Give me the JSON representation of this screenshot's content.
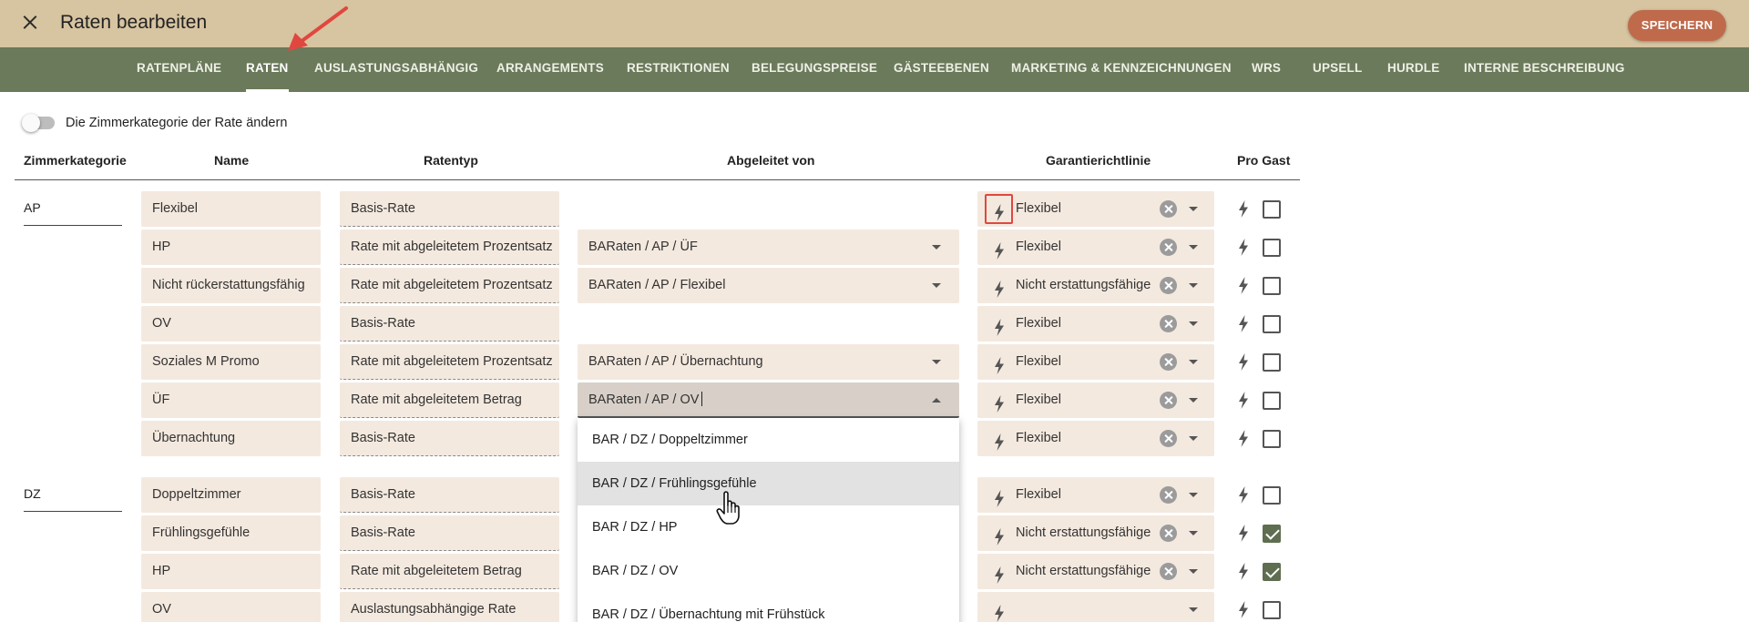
{
  "header": {
    "title": "Raten bearbeiten",
    "save_label": "SPEICHERN"
  },
  "tabs": [
    {
      "label": "RATENPLÄNE"
    },
    {
      "label": "RATEN"
    },
    {
      "label": "AUSLASTUNGSABHÄNGIG"
    },
    {
      "label": "ARRANGEMENTS"
    },
    {
      "label": "RESTRIKTIONEN"
    },
    {
      "label": "BELEGUNGSPREISE"
    },
    {
      "label": "GÄSTEEBENEN"
    },
    {
      "label": "MARKETING & KENNZEICHNUNGEN"
    },
    {
      "label": "WRS"
    },
    {
      "label": "UPSELL"
    },
    {
      "label": "HURDLE"
    },
    {
      "label": "INTERNE BESCHREIBUNG"
    }
  ],
  "toggle": {
    "label": "Die Zimmerkategorie der Rate ändern",
    "checked": false
  },
  "columns": {
    "zimmerkategorie": "Zimmerkategorie",
    "name": "Name",
    "ratentyp": "Ratentyp",
    "abgeleitet": "Abgeleitet von",
    "garantie": "Garantierichtlinie",
    "pro_gast": "Pro Gast"
  },
  "groups": [
    {
      "name": "AP",
      "rows": [
        {
          "name": "Flexibel",
          "type": "Basis-Rate",
          "derived": "",
          "guarantee": "Flexibel",
          "pro_gast": false
        },
        {
          "name": "HP",
          "type": "Rate mit abgeleitetem Prozentsatz",
          "derived": "BARaten / AP / ÜF",
          "guarantee": "Flexibel",
          "pro_gast": false
        },
        {
          "name": "Nicht rückerstattungsfähig",
          "type": "Rate mit abgeleitetem Prozentsatz",
          "derived": "BARaten / AP / Flexibel",
          "guarantee": "Nicht erstattungsfähige",
          "pro_gast": false
        },
        {
          "name": "OV",
          "type": "Basis-Rate",
          "derived": "",
          "guarantee": "Flexibel",
          "pro_gast": false
        },
        {
          "name": "Soziales M Promo",
          "type": "Rate mit abgeleitetem Prozentsatz",
          "derived": "BARaten / AP / Übernachtung",
          "guarantee": "Flexibel",
          "pro_gast": false
        },
        {
          "name": "ÜF",
          "type": "Rate mit abgeleitetem Betrag",
          "derived": "BARaten / AP / OV",
          "guarantee": "Flexibel",
          "pro_gast": false
        },
        {
          "name": "Übernachtung",
          "type": "Basis-Rate",
          "derived": "",
          "guarantee": "Flexibel",
          "pro_gast": false
        }
      ]
    },
    {
      "name": "DZ",
      "rows": [
        {
          "name": "Doppeltzimmer",
          "type": "Basis-Rate",
          "derived": "",
          "guarantee": "Flexibel",
          "pro_gast": false
        },
        {
          "name": "Frühlingsgefühle",
          "type": "Basis-Rate",
          "derived": "",
          "guarantee": "Nicht erstattungsfähige",
          "pro_gast": true
        },
        {
          "name": "HP",
          "type": "Rate mit abgeleitetem Betrag",
          "derived": "",
          "guarantee": "Nicht erstattungsfähige",
          "pro_gast": true
        },
        {
          "name": "OV",
          "type": "Auslastungsabhängige Rate",
          "derived": "",
          "guarantee": "",
          "pro_gast": false
        }
      ]
    }
  ],
  "dropdown": {
    "options": [
      "BAR / DZ / Doppeltzimmer",
      "BAR / DZ / Frühlingsgefühle",
      "BAR / DZ / HP",
      "BAR / DZ / OV",
      "BAR / DZ / Übernachtung mit Frühstück"
    ],
    "highlighted": "BAR / DZ / Frühlingsgefühle"
  },
  "colors": {
    "header_bg": "#d7c4a0",
    "tabbar_bg": "#6b7a5b",
    "save_button": "#c06a4c",
    "cell_bg": "#f4e9df",
    "checkbox_checked": "#5f6d50",
    "annotation_red": "#e0473f"
  },
  "icons": {
    "close": "close-icon",
    "bolt": "lightning-icon",
    "clear": "clear-circle-icon",
    "dropdown": "chevron-down-icon",
    "pointer": "hand-pointer-icon",
    "annotation": "red-arrow-icon"
  }
}
